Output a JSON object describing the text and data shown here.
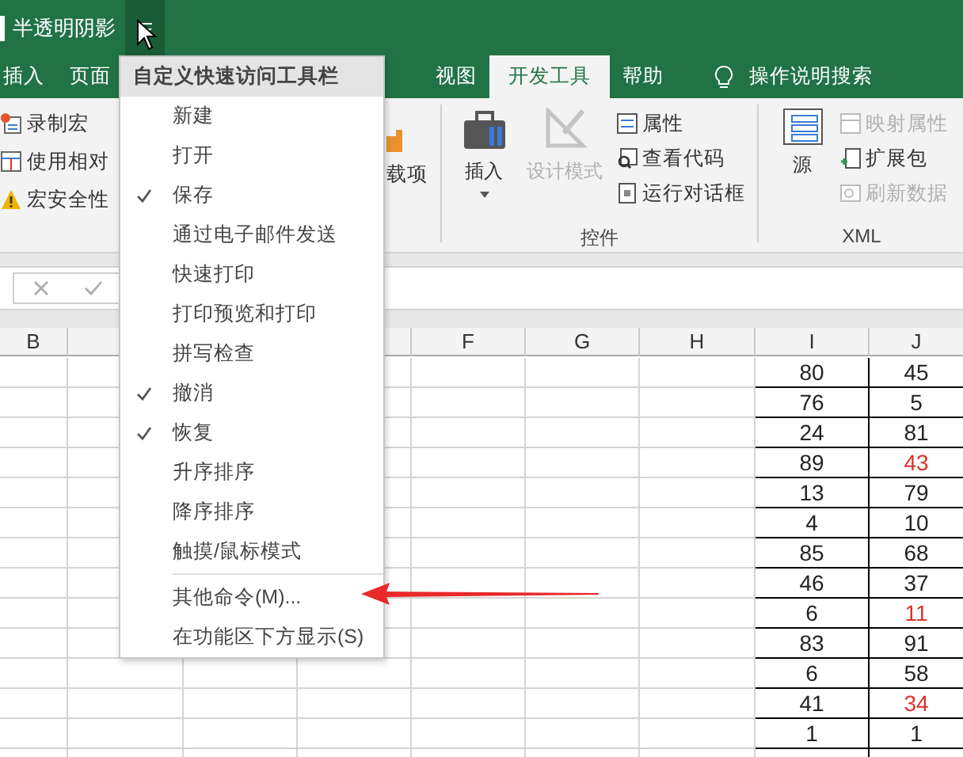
{
  "title_bar": {
    "document": "半透明阴影"
  },
  "tabs": [
    {
      "label": "插入",
      "selected": false
    },
    {
      "label": "页面",
      "selected": false
    },
    {
      "label": "视图",
      "selected": false
    },
    {
      "label": "开发工具",
      "selected": true
    },
    {
      "label": "帮助",
      "selected": false
    }
  ],
  "search": {
    "label": "操作说明搜索"
  },
  "ribbon": {
    "code_items": [
      {
        "label": "录制宏",
        "kind": "record"
      },
      {
        "label": "使用相对",
        "kind": "relative"
      },
      {
        "label": "宏安全性",
        "kind": "warning"
      }
    ],
    "addins_label": "载项",
    "controls": {
      "insert": "插入",
      "design": {
        "label": "设计模式",
        "disabled": true
      },
      "items": [
        {
          "label": "属性",
          "kind": "properties"
        },
        {
          "label": "查看代码",
          "kind": "code"
        },
        {
          "label": "运行对话框",
          "kind": "dialog"
        }
      ],
      "label": "控件"
    },
    "xml": {
      "source": "源",
      "items": [
        {
          "label": "映射属性",
          "disabled": true,
          "kind": "map"
        },
        {
          "label": "扩展包",
          "disabled": false,
          "kind": "pack"
        },
        {
          "label": "刷新数据",
          "disabled": true,
          "kind": "refresh"
        }
      ],
      "label": "XML"
    }
  },
  "sheet": {
    "columns": [
      {
        "label": "B"
      },
      {},
      {},
      {},
      {
        "label": "F"
      },
      {
        "label": "G"
      },
      {
        "label": "H"
      },
      {
        "label": "I"
      },
      {
        "label": "J"
      }
    ],
    "rows": [
      [
        {
          "text": "80",
          "color": "#222222"
        },
        {
          "text": "45",
          "color": "#222222"
        }
      ],
      [
        {
          "text": "76",
          "color": "#222222"
        },
        {
          "text": "5",
          "color": "#222222"
        }
      ],
      [
        {
          "text": "24",
          "color": "#222222"
        },
        {
          "text": "81",
          "color": "#222222"
        }
      ],
      [
        {
          "text": "89",
          "color": "#222222"
        },
        {
          "text": "43",
          "color": "#d9342b"
        }
      ],
      [
        {
          "text": "13",
          "color": "#222222"
        },
        {
          "text": "79",
          "color": "#222222"
        }
      ],
      [
        {
          "text": "4",
          "color": "#222222"
        },
        {
          "text": "10",
          "color": "#222222"
        }
      ],
      [
        {
          "text": "85",
          "color": "#222222"
        },
        {
          "text": "68",
          "color": "#222222"
        }
      ],
      [
        {
          "text": "46",
          "color": "#222222"
        },
        {
          "text": "37",
          "color": "#222222"
        }
      ],
      [
        {
          "text": "6",
          "color": "#222222"
        },
        {
          "text": "11",
          "color": "#d9342b"
        }
      ],
      [
        {
          "text": "83",
          "color": "#222222"
        },
        {
          "text": "91",
          "color": "#222222"
        }
      ],
      [
        {
          "text": "6",
          "color": "#222222"
        },
        {
          "text": "58",
          "color": "#222222"
        }
      ],
      [
        {
          "text": "41",
          "color": "#222222"
        },
        {
          "text": "34",
          "color": "#d9342b"
        }
      ],
      [
        {
          "text": "1",
          "color": "#222222"
        },
        {
          "text": "1",
          "color": "#222222"
        }
      ]
    ]
  },
  "menu": {
    "title": "自定义快速访问工具栏",
    "items": [
      {
        "label": "新建",
        "checked": false
      },
      {
        "label": "打开",
        "checked": false
      },
      {
        "label": "保存",
        "checked": true
      },
      {
        "label": "通过电子邮件发送",
        "checked": false
      },
      {
        "label": "快速打印",
        "checked": false
      },
      {
        "label": "打印预览和打印",
        "checked": false
      },
      {
        "label": "拼写检查",
        "checked": false
      },
      {
        "label": "撤消",
        "checked": true
      },
      {
        "label": "恢复",
        "checked": true
      },
      {
        "label": "升序排序",
        "checked": false
      },
      {
        "label": "降序排序",
        "checked": false
      },
      {
        "label": "触摸/鼠标模式",
        "checked": false
      }
    ],
    "more_items": [
      {
        "label": "其他命令(M)..."
      },
      {
        "label": "在功能区下方显示(S)"
      }
    ]
  }
}
